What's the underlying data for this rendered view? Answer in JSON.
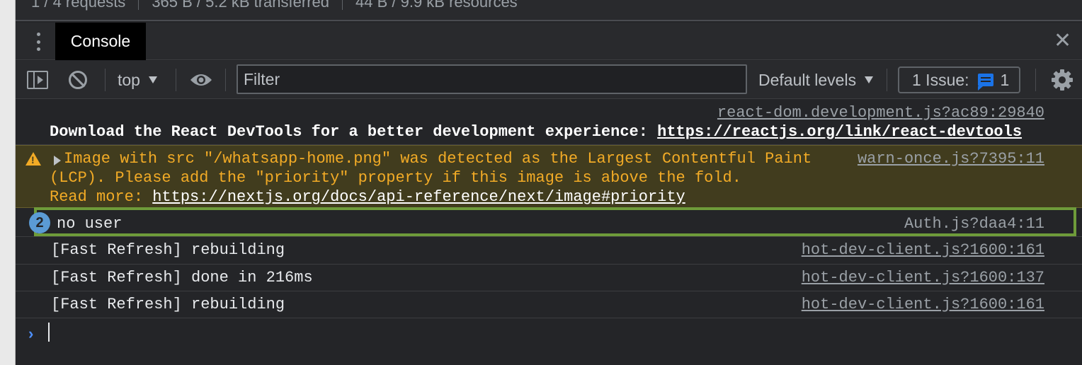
{
  "statusbar": {
    "requests": "1 / 4 requests",
    "transferred": "365 B / 5.2 kB transferred",
    "resources": "44 B / 9.9 kB resources"
  },
  "tabs": [
    {
      "label": "Console"
    }
  ],
  "toolbar": {
    "context": "top",
    "filter_placeholder": "Filter",
    "levels": "Default levels",
    "issues_label": "1 Issue:",
    "issues_count": "1"
  },
  "messages": {
    "devtools": {
      "source": "react-dom.development.js?ac89:29840",
      "text": "Download the React DevTools for a better development experience: ",
      "link": "https://reactjs.org/link/react-devtools"
    },
    "warning": {
      "line1": "Image with src \"/whatsapp-home.png\" was detected as the Largest Contentful Paint",
      "line2": "(LCP). Please add the \"priority\" property if this image is above the fold.",
      "readmore": "Read more: ",
      "link": "https://nextjs.org/docs/api-reference/next/image#priority",
      "source": "warn-once.js?7395:11"
    },
    "log": [
      {
        "count": "2",
        "text": "no user",
        "source": "Auth.js?daa4:11"
      },
      {
        "text": "[Fast Refresh] rebuilding",
        "source": "hot-dev-client.js?1600:161"
      },
      {
        "text": "[Fast Refresh] done in 216ms",
        "source": "hot-dev-client.js?1600:137"
      },
      {
        "text": "[Fast Refresh] rebuilding",
        "source": "hot-dev-client.js?1600:161"
      }
    ]
  },
  "colors": {
    "background": "#242528",
    "warning_bg": "#413c1e",
    "warning_text": "#f2ab26",
    "highlight_border": "#6e9b3a",
    "accent_blue": "#1a73e8"
  },
  "icons": [
    "kebab-menu-icon",
    "close-icon",
    "sidebar-toggle-icon",
    "clear-console-icon",
    "eye-icon",
    "issue-icon",
    "gear-icon",
    "warning-icon",
    "expand-triangle-icon",
    "prompt-chevron-icon"
  ]
}
